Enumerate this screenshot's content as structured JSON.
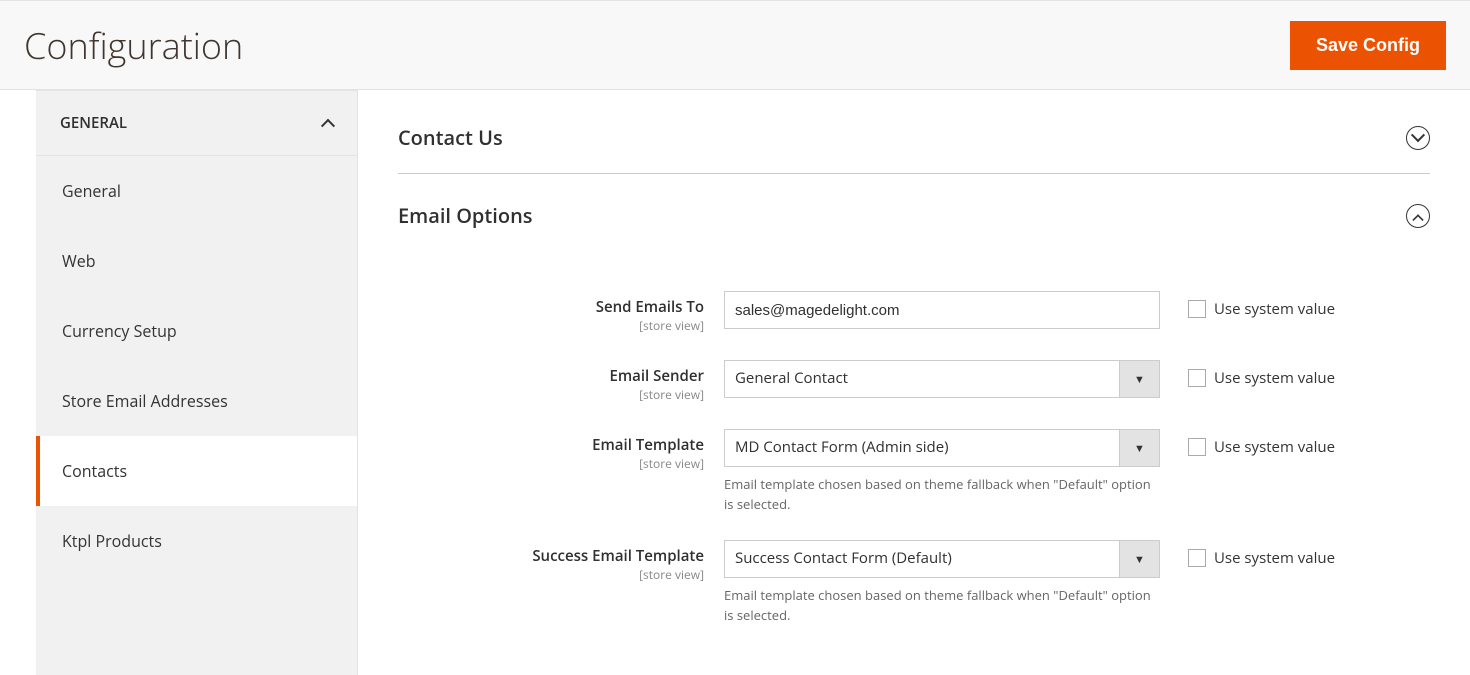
{
  "page": {
    "title": "Configuration",
    "save_label": "Save Config"
  },
  "sidebar": {
    "group_label": "GENERAL",
    "items": [
      {
        "label": "General",
        "active": false
      },
      {
        "label": "Web",
        "active": false
      },
      {
        "label": "Currency Setup",
        "active": false
      },
      {
        "label": "Store Email Addresses",
        "active": false
      },
      {
        "label": "Contacts",
        "active": true
      },
      {
        "label": "Ktpl Products",
        "active": false
      }
    ]
  },
  "sections": {
    "contact_us": {
      "title": "Contact Us",
      "expanded": false
    },
    "email_options": {
      "title": "Email Options",
      "expanded": true
    }
  },
  "scope_note": "[store view]",
  "use_system_label": "Use system value",
  "fields": {
    "send_emails_to": {
      "label": "Send Emails To",
      "value": "sales@magedelight.com"
    },
    "email_sender": {
      "label": "Email Sender",
      "value": "General Contact"
    },
    "email_template": {
      "label": "Email Template",
      "value": "MD Contact Form (Admin side)",
      "help": "Email template chosen based on theme fallback when \"Default\" option is selected."
    },
    "success_email_template": {
      "label": "Success Email Template",
      "value": "Success Contact Form (Default)",
      "help": "Email template chosen based on theme fallback when \"Default\" option is selected."
    }
  }
}
